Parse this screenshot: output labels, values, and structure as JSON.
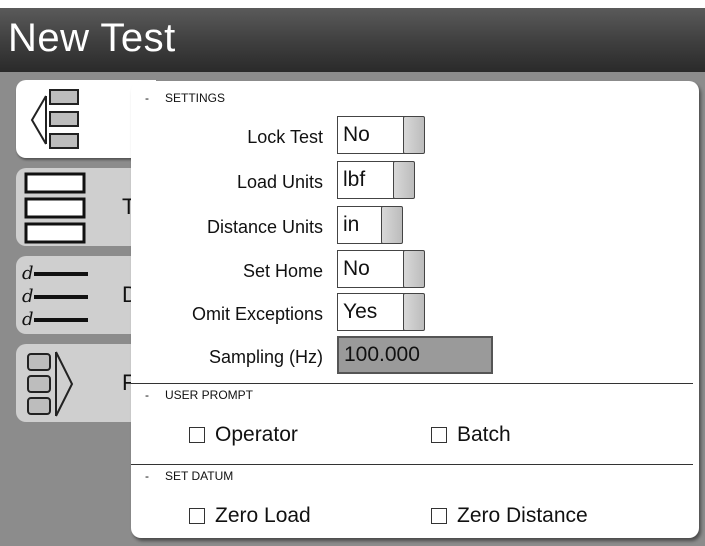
{
  "window": {
    "title": "New Test"
  },
  "tabs": [
    {
      "label": "T",
      "icon": "stacked-boxes-icon"
    },
    {
      "label": "D",
      "icon": "data-lines-icon"
    },
    {
      "label": "F",
      "icon": "forward-boxes-icon"
    }
  ],
  "settings": {
    "header": "SETTINGS",
    "rows": [
      {
        "label": "Lock Test",
        "value": "No"
      },
      {
        "label": "Load Units",
        "value": "lbf"
      },
      {
        "label": "Distance Units",
        "value": "in"
      },
      {
        "label": "Set Home",
        "value": "No"
      },
      {
        "label": "Omit Exceptions",
        "value": "Yes"
      }
    ],
    "sampling": {
      "label": "Sampling (Hz)",
      "value": "100.000"
    }
  },
  "user_prompt": {
    "header": "USER PROMPT",
    "options": [
      {
        "label": "Operator",
        "checked": false
      },
      {
        "label": "Batch",
        "checked": false
      }
    ]
  },
  "set_datum": {
    "header": "SET DATUM",
    "options": [
      {
        "label": "Zero Load",
        "checked": false
      },
      {
        "label": "Zero Distance",
        "checked": false
      }
    ]
  },
  "section_marker": "-",
  "icon_glyph": "d"
}
